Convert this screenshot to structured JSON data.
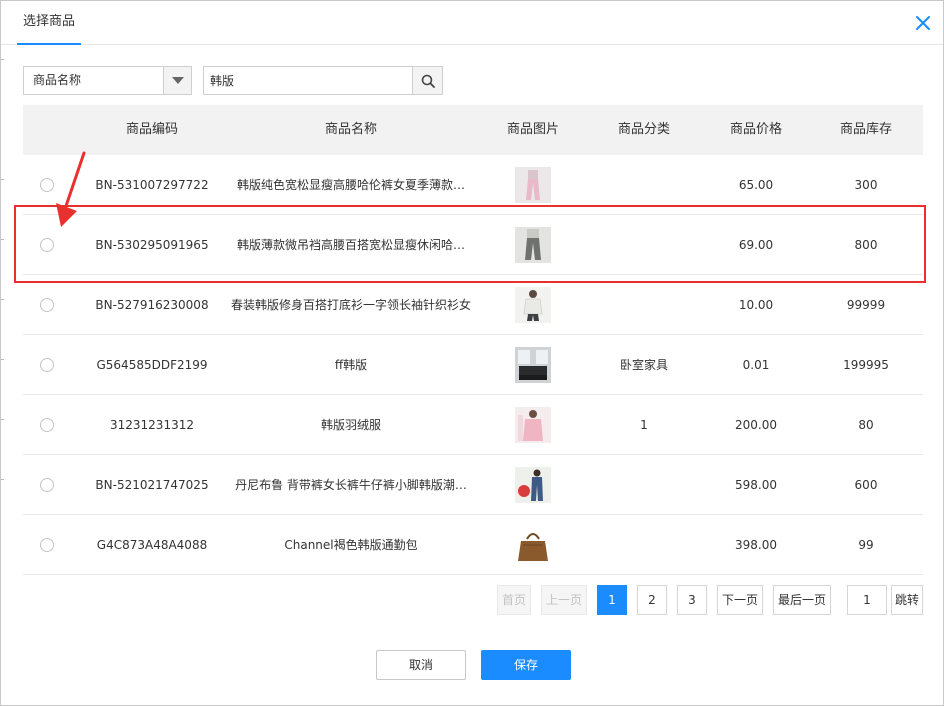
{
  "dialog": {
    "tab_label": "选择商品",
    "close_icon": "close-icon"
  },
  "filter": {
    "field_selected": "商品名称",
    "search_value": "韩版"
  },
  "table": {
    "columns": [
      "商品编码",
      "商品名称",
      "商品图片",
      "商品分类",
      "商品价格",
      "商品库存"
    ],
    "rows": [
      {
        "code": "BN-531007297722",
        "name": "韩版纯色宽松显瘦高腰哈伦裤女夏季薄款…",
        "category": "",
        "price": "65.00",
        "stock": "300"
      },
      {
        "code": "BN-530295091965",
        "name": "韩版薄款微吊裆高腰百搭宽松显瘦休闲哈…",
        "category": "",
        "price": "69.00",
        "stock": "800"
      },
      {
        "code": "BN-527916230008",
        "name": "春装韩版修身百搭打底衫一字领长袖针织衫女",
        "category": "",
        "price": "10.00",
        "stock": "99999"
      },
      {
        "code": "G564585DDF2199",
        "name": "ff韩版",
        "category": "卧室家具",
        "price": "0.01",
        "stock": "199995"
      },
      {
        "code": "31231231312",
        "name": "韩版羽绒服",
        "category": "1",
        "price": "200.00",
        "stock": "80"
      },
      {
        "code": "BN-521021747025",
        "name": "丹尼布鲁 背带裤女长裤牛仔裤小脚韩版潮…",
        "category": "",
        "price": "598.00",
        "stock": "600"
      },
      {
        "code": "G4C873A48A4088",
        "name": "Channel褐色韩版通勤包",
        "category": "",
        "price": "398.00",
        "stock": "99"
      }
    ]
  },
  "pagination": {
    "first": "首页",
    "prev": "上一页",
    "pages": [
      "1",
      "2",
      "3"
    ],
    "current": "1",
    "next": "下一页",
    "last": "最后一页",
    "jump_value": "1",
    "jump": "跳转"
  },
  "footer": {
    "cancel": "取消",
    "save": "保存"
  },
  "colors": {
    "accent": "#1a8cff",
    "highlight": "#e8312f"
  }
}
